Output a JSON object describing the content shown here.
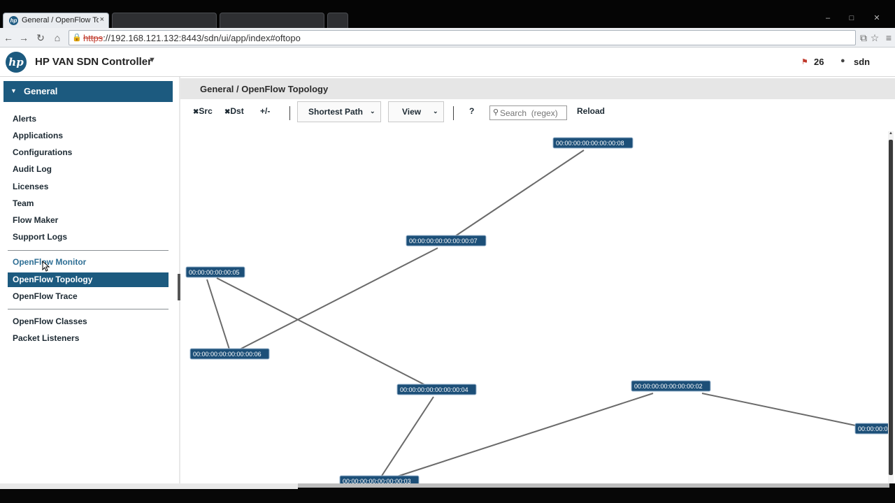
{
  "browser": {
    "active_tab": {
      "title": "General / OpenFlow Topo",
      "close": "×",
      "favicon": "hp"
    },
    "window_controls": {
      "minimize": "–",
      "maximize": "□",
      "close": "✕"
    },
    "url_scheme": "https",
    "url_rest": "://192.168.121.132:8443/sdn/ui/app/index#oftopo",
    "nav": {
      "back": "←",
      "forward": "→",
      "reload": "↻",
      "home": "⌂"
    }
  },
  "header": {
    "logo": "hp",
    "title": "HP VAN SDN Controller",
    "alert_count": "26",
    "user": "sdn"
  },
  "sidebar": {
    "group": "General",
    "items_top": [
      "Alerts",
      "Applications",
      "Configurations",
      "Audit Log",
      "Licenses",
      "Team",
      "Flow Maker",
      "Support Logs"
    ],
    "items_openflow": [
      "OpenFlow Monitor",
      "OpenFlow Topology",
      "OpenFlow Trace"
    ],
    "items_bottom": [
      "OpenFlow Classes",
      "Packet Listeners"
    ],
    "selected": "OpenFlow Topology",
    "hovered": "OpenFlow Monitor"
  },
  "main": {
    "breadcrumb": "General / OpenFlow Topology",
    "toolbar": {
      "src": "Src",
      "dst": "Dst",
      "plus_minus": "+/-",
      "shortest_path": "Shortest Path",
      "view": "View",
      "help": "?",
      "search_placeholder": "Search  (regex)",
      "reload": "Reload"
    }
  },
  "topology": {
    "nodes": [
      {
        "id": "n8",
        "label": "00:00:00:00:00:00:00:08"
      },
      {
        "id": "n7",
        "label": "00:00:00:00:00:00:00:07"
      },
      {
        "id": "n5",
        "label": "00:00:00:00:00:05"
      },
      {
        "id": "n6",
        "label": "00:00:00:00:00:00:00:06"
      },
      {
        "id": "n4",
        "label": "00:00:00:00:00:00:00:04"
      },
      {
        "id": "n2",
        "label": "00:00:00:00:00:00:00:02"
      },
      {
        "id": "n3",
        "label": "00:00:00:00:00:00:00:03"
      },
      {
        "id": "n1",
        "label": "00:00:00:0"
      }
    ],
    "links": [
      [
        "n8",
        "n7"
      ],
      [
        "n7",
        "n6"
      ],
      [
        "n5",
        "n6"
      ],
      [
        "n5",
        "n4"
      ],
      [
        "n4",
        "n3"
      ],
      [
        "n3",
        "n2"
      ],
      [
        "n2",
        "n1"
      ]
    ]
  }
}
